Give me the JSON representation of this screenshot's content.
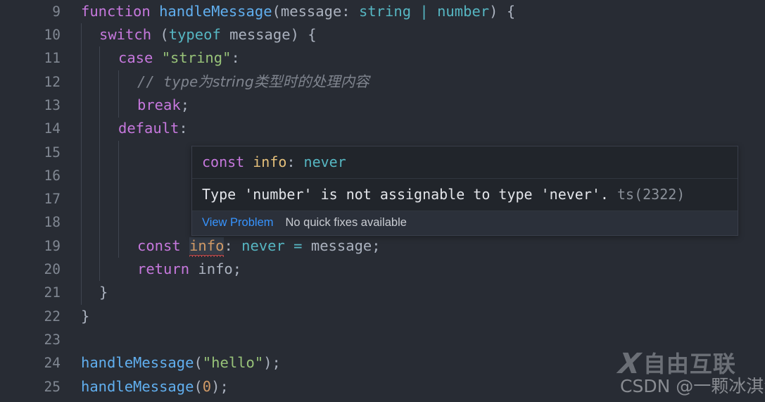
{
  "editor": {
    "theme_background": "#282c34",
    "default_text_color": "#abb2bf",
    "line_number_color": "#808792",
    "first_line_number": 9,
    "lines": [
      {
        "n": "9",
        "text": "function handleMessage(message: string | number) {"
      },
      {
        "n": "10",
        "text": "  switch (typeof message) {"
      },
      {
        "n": "11",
        "text": "    case \"string\":"
      },
      {
        "n": "12",
        "text": "      // type为string类型时的处理内容"
      },
      {
        "n": "13",
        "text": "      break;"
      },
      {
        "n": "14",
        "text": "    default:"
      },
      {
        "n": "15",
        "text": ""
      },
      {
        "n": "16",
        "text": ""
      },
      {
        "n": "17",
        "text": ""
      },
      {
        "n": "18",
        "text": ""
      },
      {
        "n": "19",
        "text": "      const info: never = message;"
      },
      {
        "n": "20",
        "text": "      return info;"
      },
      {
        "n": "21",
        "text": "  }"
      },
      {
        "n": "22",
        "text": "}"
      },
      {
        "n": "23",
        "text": ""
      },
      {
        "n": "24",
        "text": "handleMessage(\"hello\");"
      },
      {
        "n": "25",
        "text": "handleMessage(0);"
      }
    ],
    "tokens": {
      "l9": {
        "kw": "function",
        "fn": "handleMessage",
        "p1": "(",
        "param": "message",
        "colon": ": ",
        "t1": "string",
        "pipe": " | ",
        "t2": "number",
        "p2": ") ",
        "brace": "{"
      },
      "l10": {
        "kw": "switch",
        "p1": " (",
        "typeof": "typeof",
        "param": " message",
        "p2": ") ",
        "brace": "{"
      },
      "l11": {
        "kw": "case",
        "str": "\"string\"",
        "colon": ":"
      },
      "l12": {
        "slashes": "// ",
        "comment_ascii": "type",
        "comment_cjk": "为string类型时的处理内容"
      },
      "l13": {
        "kw": "break",
        "semi": ";"
      },
      "l14": {
        "kw": "default",
        "colon": ":"
      },
      "l19": {
        "kw": "const",
        "ident": "info",
        "colon": ": ",
        "type": "never",
        "eq": " = ",
        "value": "message",
        "semi": ";"
      },
      "l20": {
        "kw": "return",
        "ident": " info",
        "semi": ";"
      },
      "l21": {
        "brace": "}"
      },
      "l22": {
        "brace": "}"
      },
      "l24": {
        "fn": "handleMessage",
        "p1": "(",
        "str": "\"hello\"",
        "p2": ")",
        "semi": ";"
      },
      "l25": {
        "fn": "handleMessage",
        "p1": "(",
        "num": "0",
        "p2": ")",
        "semi": ";"
      }
    },
    "colors": {
      "keyword": "#c678dd",
      "function": "#61afef",
      "type": "#56b6c2",
      "string": "#98c379",
      "number": "#d19a66",
      "identifier": "#d19a66",
      "comment": "#7f848e",
      "punctuation": "#abb2bf",
      "error_squiggle": "#e05252"
    }
  },
  "hover": {
    "signature": {
      "keyword": "const",
      "name": " info",
      "colon": ": ",
      "type": "never"
    },
    "signature_text": "const info: never",
    "message": "Type 'number' is not assignable to type 'never'.",
    "error_code": "ts(2322)",
    "actions": {
      "view_problem_label": "View Problem",
      "quick_fix_label": "No quick fixes available"
    },
    "link_color": "#3794ff",
    "background": "#21252b"
  },
  "watermark": {
    "logo_mark": "X",
    "logo_text": "自由互联",
    "attribution": "CSDN @一颗冰淇淋"
  }
}
